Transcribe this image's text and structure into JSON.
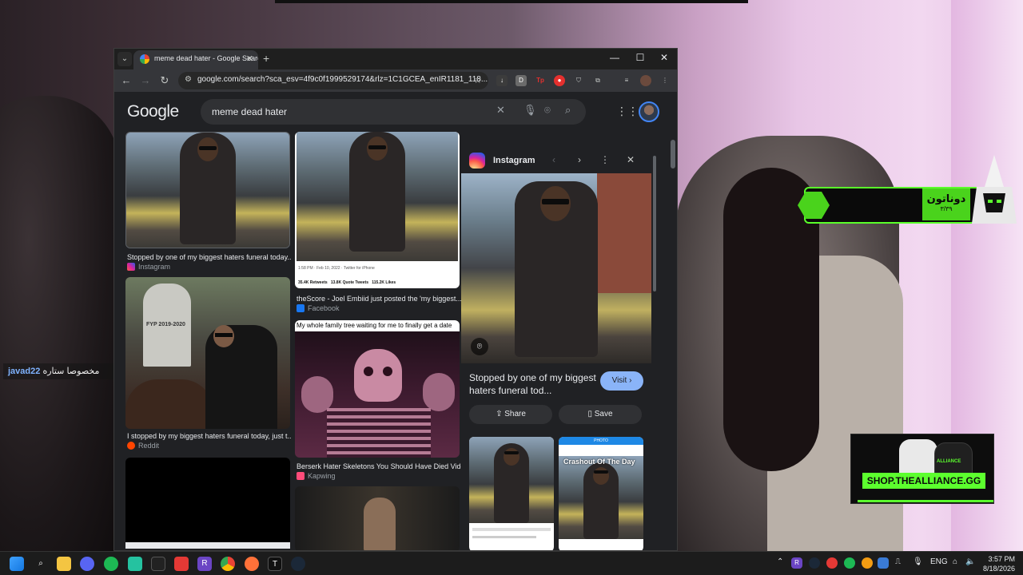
{
  "overlay": {
    "donation_label": "دوناتون",
    "donation_sub": "٣/٣٩",
    "chat_user": "javad22",
    "chat_text": "مخصوصا ستاره",
    "shop_label": "SHOP.THEALLIANCE.GG",
    "shop_hoodie_text": "ALLIANCE"
  },
  "browser": {
    "tab_title": "meme dead hater - Google Search",
    "new_tab": "+",
    "url": "google.com/search?sca_esv=4f9c0f1999529174&rlz=1C1GCEA_enIR1181_118...",
    "window_controls": {
      "minimize": "—",
      "maximize": "☐",
      "close": "✕"
    }
  },
  "google": {
    "logo": "Google",
    "query": "meme dead hater"
  },
  "results": {
    "col1": [
      {
        "caption": "Stopped by one of my biggest haters funeral today...",
        "source": "Instagram"
      },
      {
        "caption": "I stopped by my biggest haters funeral today, just t...",
        "source": "Reddit",
        "tombstone": "FYP 2019-2020"
      }
    ],
    "col2": [
      {
        "caption": "theScore - Joel Embiid just posted the 'my biggest...",
        "source": "Facebook",
        "tweet_date": "1:58 PM · Feb 10, 2022 · Twitter for iPhone",
        "tweet_stats": [
          "35.4K Retweets",
          "13.8K Quote Tweets",
          "115.2K Likes"
        ]
      },
      {
        "header": "My whole family tree waiting for me to finally get a date",
        "caption": "Berserk Hater Skeletons You Should Have Died Vide...",
        "source": "Kapwing"
      }
    ]
  },
  "panel": {
    "source": "Instagram",
    "title": "Stopped by one of my biggest haters funeral tod...",
    "visit": "Visit",
    "share": "Share",
    "save": "Save",
    "thumb2_header": "PHOTO",
    "thumb2_text": "Crashout Of The Day"
  },
  "taskbar": {
    "lang": "ENG",
    "time": "3:57 PM",
    "date": "8/18/2026"
  },
  "colors": {
    "accent": "#8ab4f8",
    "alliance_green": "#5cff2e",
    "page_bg": "#202124"
  }
}
